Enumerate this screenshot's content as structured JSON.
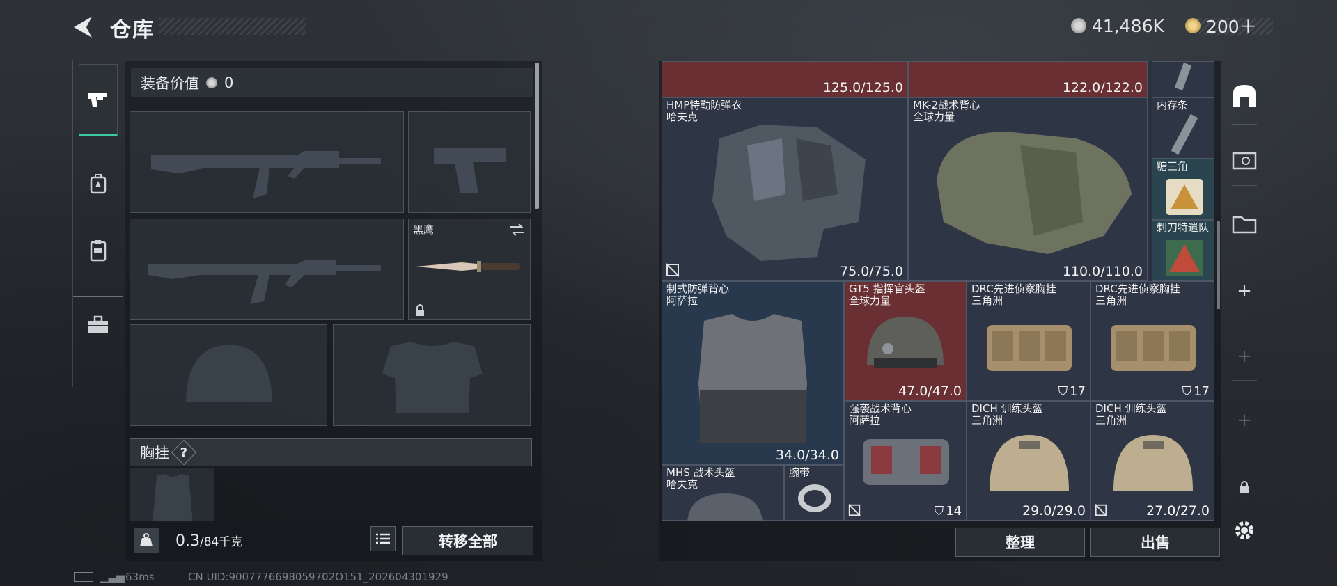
{
  "header": {
    "title": "仓库"
  },
  "currency": {
    "silver": "41,486K",
    "gold": "200＋"
  },
  "equipment": {
    "value_label": "装备价值",
    "value": "0",
    "knife_name": "黑鹰",
    "chest_rig_label": "胸挂",
    "help": "?",
    "weight_current": "0.3",
    "weight_max": "/84千克",
    "transfer_all": "转移全部"
  },
  "inventory": {
    "items": [
      {
        "name": "",
        "brand": "",
        "dur": "125.0/125.0"
      },
      {
        "name": "",
        "brand": "",
        "dur": "122.0/122.0"
      },
      {
        "name": "HMP特勤防弹衣",
        "brand": "哈夫克",
        "dur": "75.0/75.0"
      },
      {
        "name": "MK-2战术背心",
        "brand": "全球力量",
        "dur": "110.0/110.0"
      },
      {
        "name": "内存条",
        "brand": "",
        "dur": ""
      },
      {
        "name": "糖三角",
        "brand": "",
        "dur": ""
      },
      {
        "name": "刺刀特遣队",
        "brand": "",
        "dur": ""
      },
      {
        "name": "制式防弹背心",
        "brand": "阿萨拉",
        "dur": "34.0/34.0"
      },
      {
        "name": "GT5 指挥官头盔",
        "brand": "全球力量",
        "dur": "47.0/47.0"
      },
      {
        "name": "DRC先进侦察胸挂",
        "brand": "三角洲",
        "count": "17"
      },
      {
        "name": "DRC先进侦察胸挂",
        "brand": "三角洲",
        "count": "17"
      },
      {
        "name": "强袭战术背心",
        "brand": "阿萨拉",
        "count": "14"
      },
      {
        "name": "DICH 训练头盔",
        "brand": "三角洲",
        "dur": "29.0/29.0"
      },
      {
        "name": "DICH 训练头盔",
        "brand": "三角洲",
        "dur": "27.0/27.0"
      },
      {
        "name": "MHS 战术头盔",
        "brand": "哈夫克",
        "dur": ""
      },
      {
        "name": "腕带",
        "brand": "",
        "dur": ""
      }
    ],
    "sort": "整理",
    "sell": "出售"
  },
  "footer": {
    "ping": "63ms",
    "uid": "CN UID:9007776698059702O151_202604301929"
  },
  "colors": {
    "accent": "#3ccaa0",
    "red_cell": "#6a2f33",
    "blue_cell": "#28394d"
  },
  "icons": [
    "back-arrow-icon",
    "pistol-icon",
    "backpack-icon",
    "vest-icon",
    "toolbox-icon",
    "safe-icon",
    "video-icon",
    "folder-icon",
    "plus-icon",
    "lock-icon",
    "gear-icon",
    "swap-icon",
    "list-icon",
    "weight-icon"
  ]
}
